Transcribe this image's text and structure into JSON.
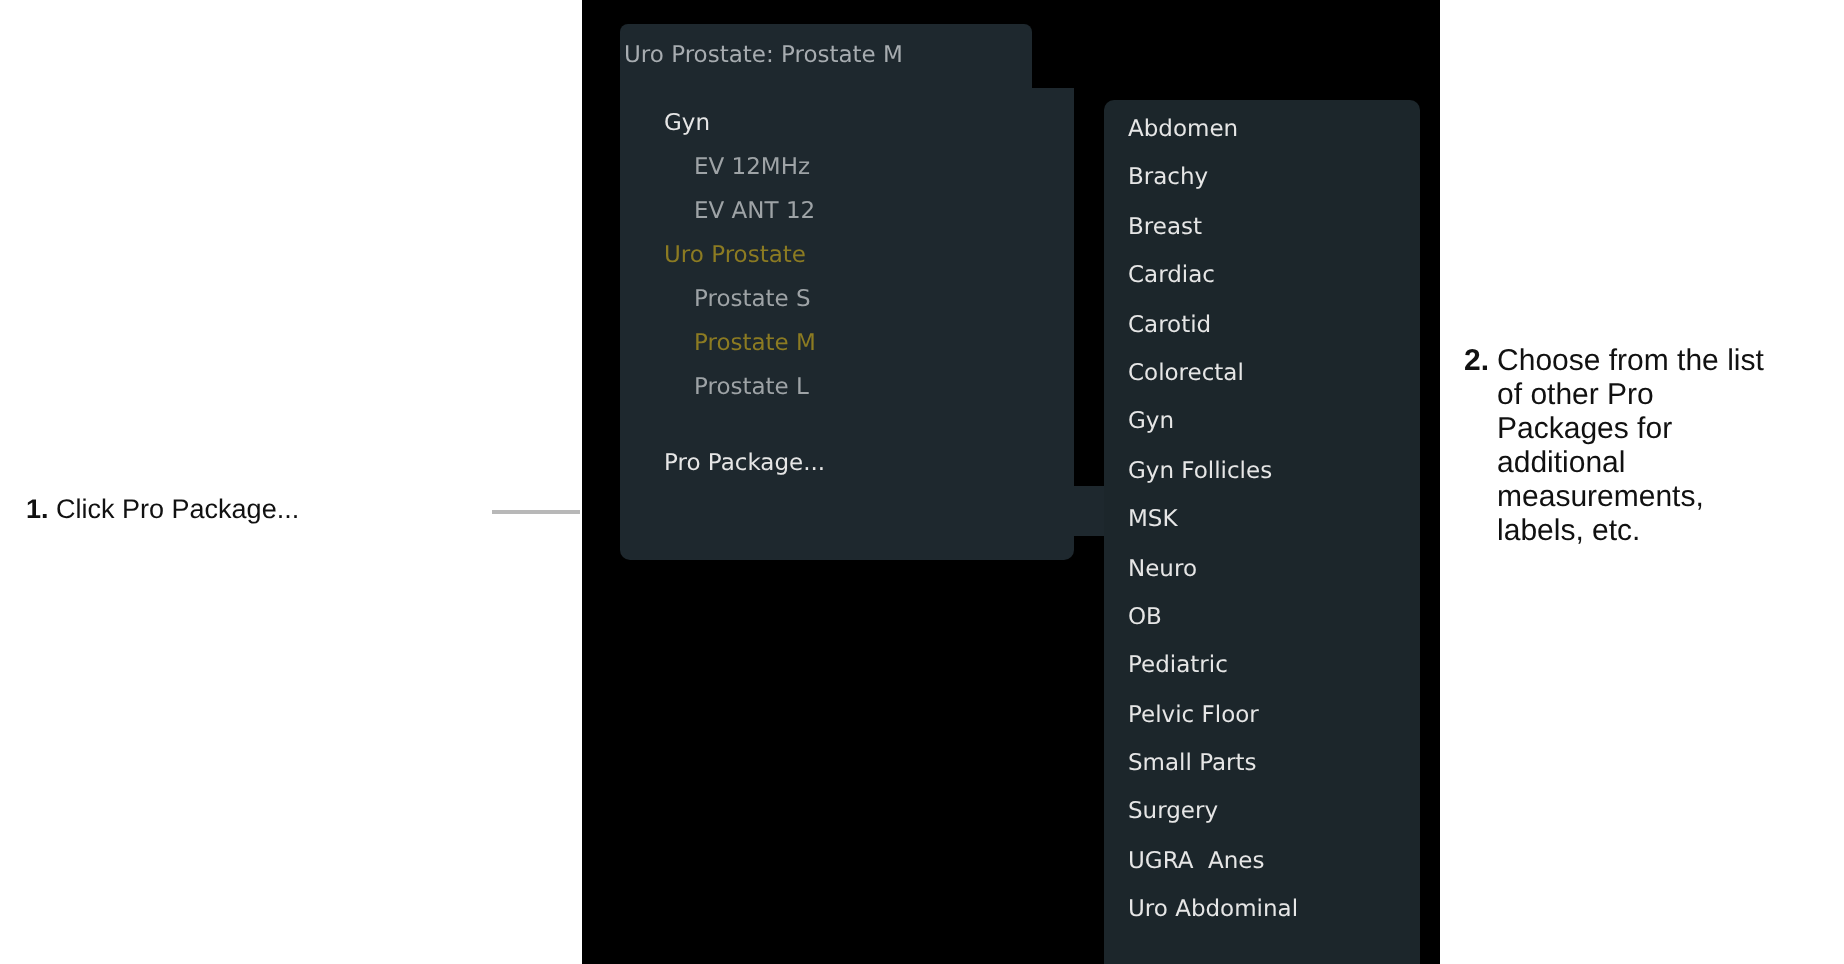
{
  "callouts": [
    {
      "number": "1.",
      "text": "Click Pro Package..."
    },
    {
      "number": "2.",
      "text": "Choose from the list of other Pro Packages for additional measurements, labels, etc."
    }
  ],
  "menu": {
    "title": "Uro Prostate: Prostate M",
    "groups": [
      {
        "label": "Gyn",
        "selected": false,
        "children": [
          {
            "label": "EV 12MHz",
            "selected": false
          },
          {
            "label": "EV ANT 12",
            "selected": false
          }
        ]
      },
      {
        "label": "Uro Prostate",
        "selected": true,
        "children": [
          {
            "label": "Prostate S",
            "selected": false
          },
          {
            "label": "Prostate M",
            "selected": true
          },
          {
            "label": "Prostate L",
            "selected": false
          }
        ]
      }
    ],
    "action": "Pro Package..."
  },
  "submenu": [
    "Abdomen",
    "Brachy",
    "Breast",
    "Cardiac",
    "Carotid",
    "Colorectal",
    "Gyn",
    "Gyn Follicles",
    "MSK",
    "Neuro",
    "OB",
    "Pediatric",
    "Pelvic Floor",
    "Small Parts",
    "Surgery",
    "UGRA  Anes",
    "Uro Abdominal"
  ]
}
